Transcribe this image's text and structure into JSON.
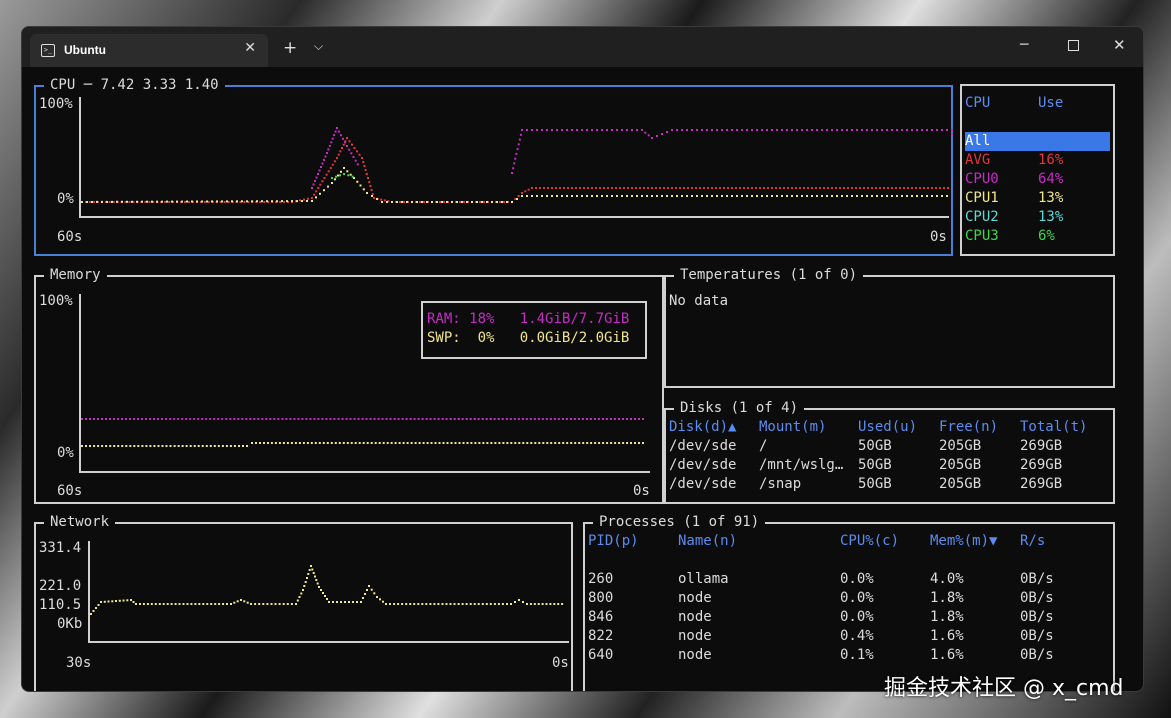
{
  "window": {
    "tab_title": "Ubuntu",
    "tab_icon": "terminal-icon"
  },
  "cpu": {
    "title": "CPU ─ 7.42 3.33 1.40",
    "y_top": "100%",
    "y_bottom": "0%",
    "x_left": "60s",
    "x_right": "0s",
    "table_header": {
      "name": "CPU",
      "use": "Use"
    },
    "rows": [
      {
        "name": "All",
        "use": "",
        "color": "#ffffff"
      },
      {
        "name": "AVG",
        "use": "16%",
        "color": "#e0353b"
      },
      {
        "name": "CPU0",
        "use": "64%",
        "color": "#c42cc4"
      },
      {
        "name": "CPU1",
        "use": "13%",
        "color": "#f0e68c"
      },
      {
        "name": "CPU2",
        "use": "13%",
        "color": "#5fd7d7"
      },
      {
        "name": "CPU3",
        "use": "6%",
        "color": "#3fd64a"
      }
    ]
  },
  "memory": {
    "title": "Memory",
    "y_top": "100%",
    "y_bottom": "0%",
    "x_left": "60s",
    "x_right": "0s",
    "ram": {
      "label": "RAM:",
      "pct": "18%",
      "detail": "1.4GiB/7.7GiB",
      "color": "#c42cc4"
    },
    "swp": {
      "label": "SWP:",
      "pct": "0%",
      "detail": "0.0GiB/2.0GiB",
      "color": "#f0e68c"
    }
  },
  "temperatures": {
    "title": "Temperatures (1 of 0)",
    "body": "No data"
  },
  "disks": {
    "title": "Disks (1 of 4)",
    "headers": [
      "Disk(d)▲",
      "Mount(m)",
      "Used(u)",
      "Free(n)",
      "Total(t)"
    ],
    "rows": [
      [
        "/dev/sde",
        "/",
        "50GB",
        "205GB",
        "269GB"
      ],
      [
        "/dev/sde",
        "/mnt/wslg…",
        "50GB",
        "205GB",
        "269GB"
      ],
      [
        "/dev/sde",
        "/snap",
        "50GB",
        "205GB",
        "269GB"
      ]
    ]
  },
  "network": {
    "title": "Network",
    "y_labels": [
      "331.4",
      "221.0",
      "110.5",
      "0Kb"
    ],
    "x_left": "30s",
    "x_right": "0s"
  },
  "processes": {
    "title": "Processes (1 of 91)",
    "headers": [
      "PID(p)",
      "Name(n)",
      "CPU%(c)",
      "Mem%(m)▼",
      "R/s"
    ],
    "rows": [
      [
        "260",
        "ollama",
        "0.0%",
        "4.0%",
        "0B/s"
      ],
      [
        "800",
        "node",
        "0.0%",
        "1.8%",
        "0B/s"
      ],
      [
        "846",
        "node",
        "0.0%",
        "1.8%",
        "0B/s"
      ],
      [
        "822",
        "node",
        "0.4%",
        "1.6%",
        "0B/s"
      ],
      [
        "640",
        "node",
        "0.1%",
        "1.6%",
        "0B/s"
      ]
    ]
  },
  "watermark": "掘金技术社区 @ x_cmd"
}
